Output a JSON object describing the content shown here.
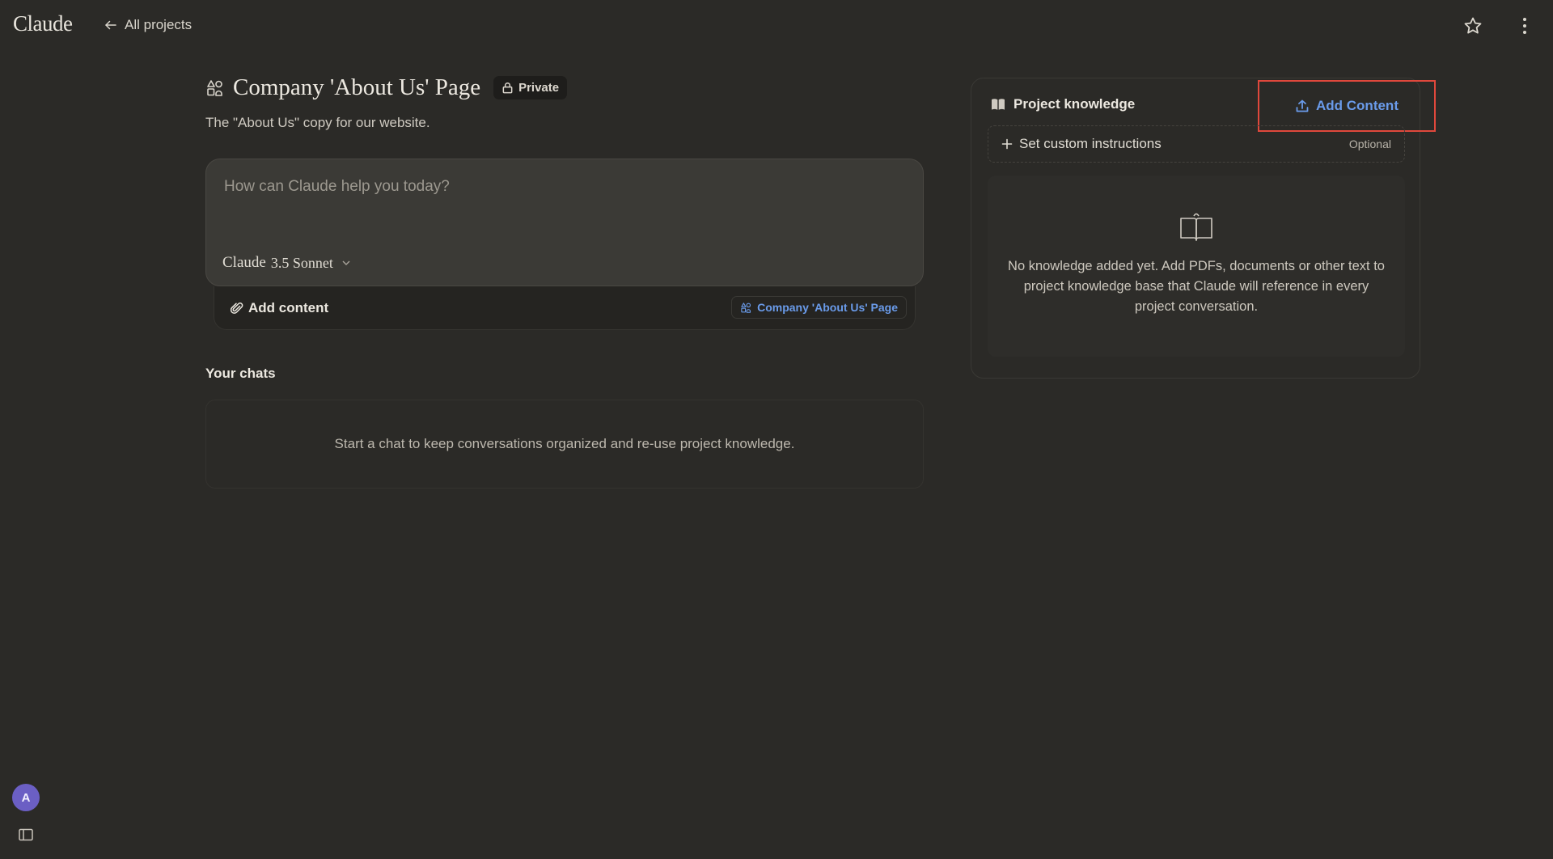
{
  "app": {
    "logo": "Claude"
  },
  "nav": {
    "back_label": "All projects"
  },
  "header_icons": {
    "star": "star-icon",
    "more": "more-vertical-icon"
  },
  "project": {
    "title": "Company 'About Us' Page",
    "visibility": "Private",
    "description": "The \"About Us\" copy for our website."
  },
  "chat": {
    "placeholder": "How can Claude help you today?",
    "model_brand": "Claude",
    "model_version": "3.5 Sonnet",
    "add_content_label": "Add content",
    "project_chip_label": "Company 'About Us' Page"
  },
  "chats": {
    "heading": "Your chats",
    "empty_message": "Start a chat to keep conversations organized and re-use project knowledge."
  },
  "knowledge": {
    "title": "Project knowledge",
    "add_content_label": "Add Content",
    "instructions_label": "Set custom instructions",
    "instructions_optional": "Optional",
    "empty_message": "No knowledge added yet. Add PDFs, documents or other text to project knowledge base that Claude will reference in every project conversation."
  },
  "user": {
    "avatar_initial": "A"
  },
  "colors": {
    "background": "#2b2a27",
    "accent_blue": "#6a9bea",
    "highlight_red": "#e0483c",
    "avatar": "#6b5fc4"
  }
}
